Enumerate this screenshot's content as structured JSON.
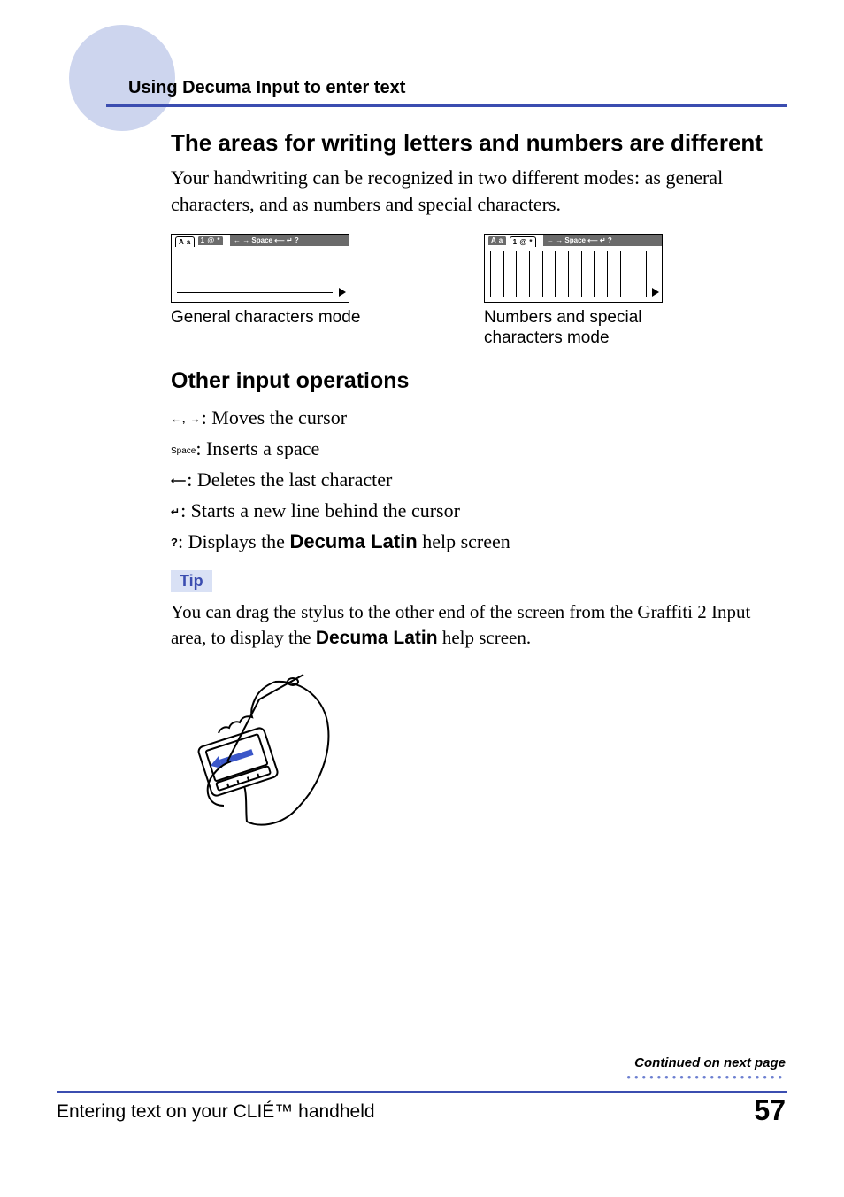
{
  "header": {
    "section_title": "Using Decuma Input to enter text"
  },
  "main": {
    "heading1": "The areas for writing letters and numbers are different",
    "intro": "Your handwriting can be recognized in two different modes: as general characters, and as numbers and special characters.",
    "modes": {
      "left": {
        "aa_tab": "A a",
        "num_tab": "1 @ *",
        "toolbar": "← → Space ⟵ ↵ ?",
        "caption": "General characters mode"
      },
      "right": {
        "aa_tab": "A a",
        "num_tab": "1 @ *",
        "toolbar": "← → Space ⟵ ↵ ?",
        "caption": "Numbers and special characters mode"
      }
    },
    "heading2": "Other input operations",
    "ops": {
      "o1_sym": "←, →",
      "o1_text": ": Moves the cursor",
      "o2_sym": "Space",
      "o2_text": ": Inserts a space",
      "o3_sym": "⟵",
      "o3_text": ": Deletes the last character",
      "o4_sym": "↵",
      "o4_text": ": Starts a new line behind the cursor",
      "o5_sym": "?",
      "o5_text_pre": ": Displays the ",
      "o5_bold": "Decuma Latin",
      "o5_text_post": " help screen"
    },
    "tip": {
      "label": "Tip",
      "text_pre": "You can drag the stylus to the other end of the screen from the Graffiti 2 Input area, to display the ",
      "bold": "Decuma Latin",
      "text_post": " help screen."
    }
  },
  "footer": {
    "continued": "Continued on next page",
    "chapter": "Entering text on your CLIÉ™ handheld",
    "page": "57"
  }
}
